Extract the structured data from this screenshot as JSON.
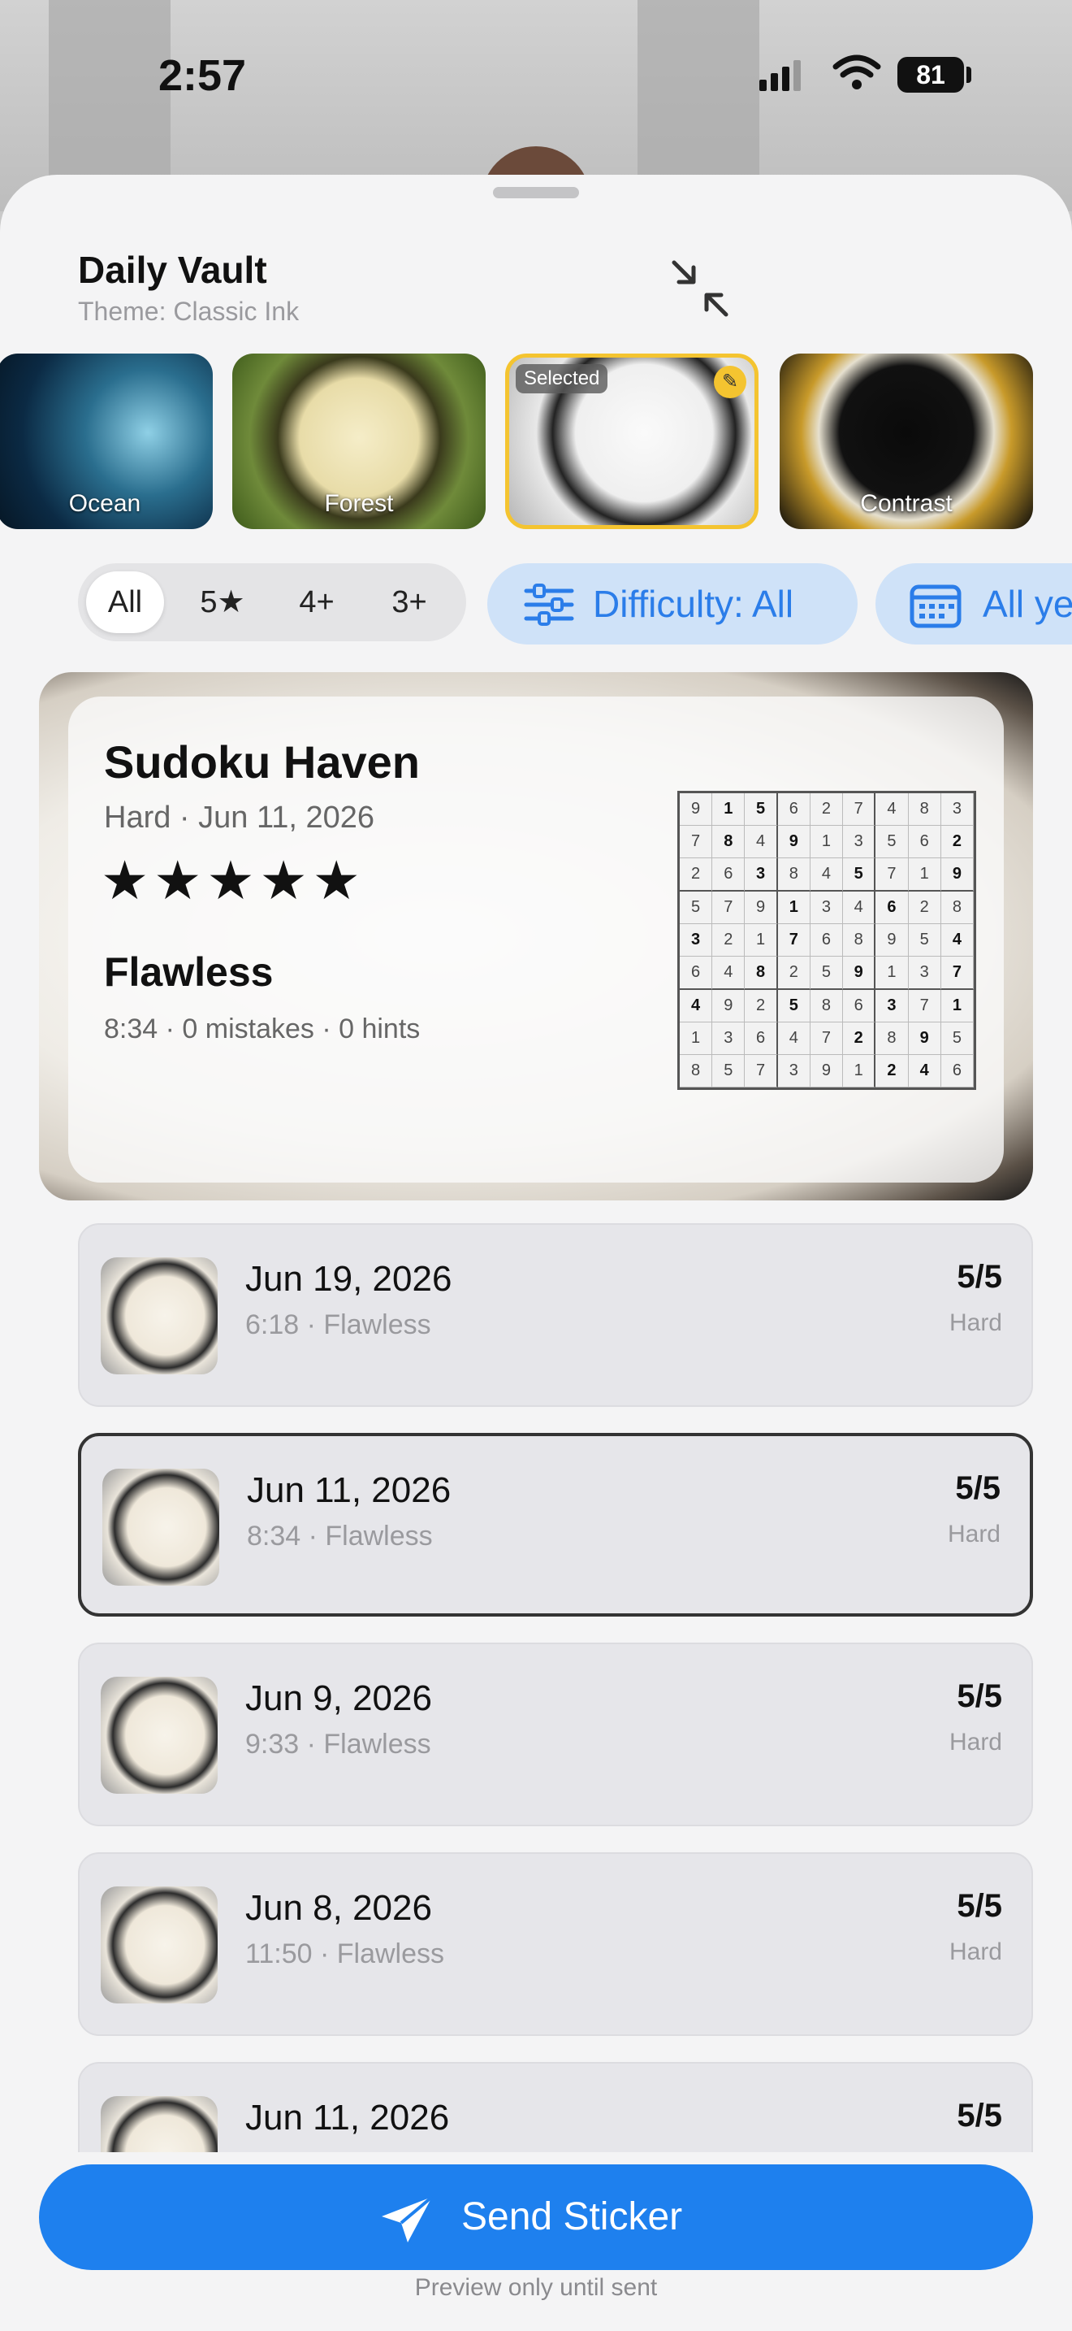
{
  "status_bar": {
    "time": "2:57",
    "battery": "81"
  },
  "header": {
    "title": "Daily Vault",
    "subtitle": "Theme: Classic Ink"
  },
  "themes": [
    {
      "label": "Ocean"
    },
    {
      "label": "Forest"
    },
    {
      "label": "",
      "badge": "Selected"
    },
    {
      "label": "Contrast"
    }
  ],
  "filters": {
    "segments": [
      "All",
      "5★",
      "4+",
      "3+"
    ],
    "difficulty": "Difficulty: All",
    "year": "All ye"
  },
  "hero": {
    "name": "Sudoku Haven",
    "meta": "Hard · Jun 11, 2026",
    "stars": "★★★★★",
    "grade": "Flawless",
    "stats": "8:34 · 0 mistakes · 0 hints",
    "grid": [
      [
        "9",
        "1",
        "5",
        "6",
        "2",
        "7",
        "4",
        "8",
        "3"
      ],
      [
        "7",
        "8",
        "4",
        "9",
        "1",
        "3",
        "5",
        "6",
        "2"
      ],
      [
        "2",
        "6",
        "3",
        "8",
        "4",
        "5",
        "7",
        "1",
        "9"
      ],
      [
        "5",
        "7",
        "9",
        "1",
        "3",
        "4",
        "6",
        "2",
        "8"
      ],
      [
        "3",
        "2",
        "1",
        "7",
        "6",
        "8",
        "9",
        "5",
        "4"
      ],
      [
        "6",
        "4",
        "8",
        "2",
        "5",
        "9",
        "1",
        "3",
        "7"
      ],
      [
        "4",
        "9",
        "2",
        "5",
        "8",
        "6",
        "3",
        "7",
        "1"
      ],
      [
        "1",
        "3",
        "6",
        "4",
        "7",
        "2",
        "8",
        "9",
        "5"
      ],
      [
        "8",
        "5",
        "7",
        "3",
        "9",
        "1",
        "2",
        "4",
        "6"
      ]
    ]
  },
  "puzzles": [
    {
      "date": "Jun 19, 2026",
      "sub": "6:18 · Flawless",
      "score": "5/5",
      "difficulty": "Hard"
    },
    {
      "date": "Jun 11, 2026",
      "sub": "8:34 · Flawless",
      "score": "5/5",
      "difficulty": "Hard"
    },
    {
      "date": "Jun 9, 2026",
      "sub": "9:33 · Flawless",
      "score": "5/5",
      "difficulty": "Hard"
    },
    {
      "date": "Jun 8, 2026",
      "sub": "11:50 · Flawless",
      "score": "5/5",
      "difficulty": "Hard"
    },
    {
      "date": "Jun 11, 2026",
      "sub": "",
      "score": "5/5",
      "difficulty": ""
    }
  ],
  "footer": {
    "send_label": "Send Sticker",
    "note": "Preview only until sent"
  }
}
